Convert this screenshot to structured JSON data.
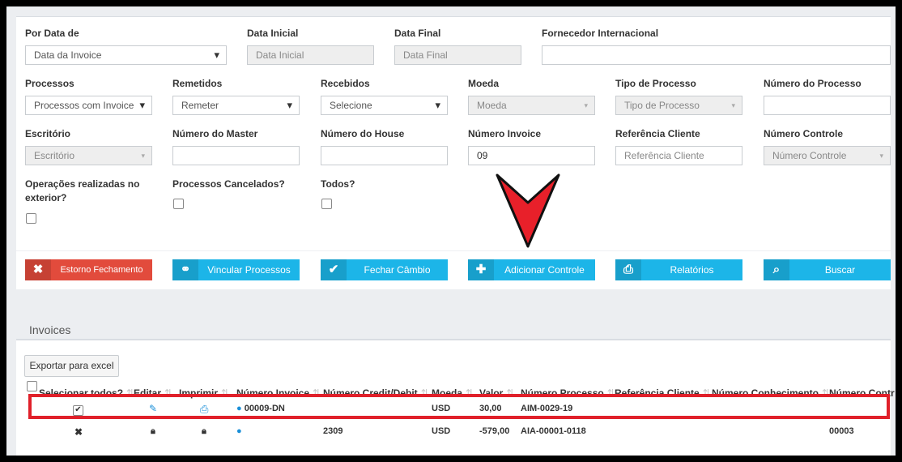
{
  "filters": {
    "por_data_de": {
      "label": "Por Data de",
      "value": "Data da Invoice"
    },
    "data_inicial": {
      "label": "Data Inicial",
      "placeholder": "Data Inicial"
    },
    "data_final": {
      "label": "Data Final",
      "placeholder": "Data Final"
    },
    "fornecedor": {
      "label": "Fornecedor Internacional",
      "value": ""
    },
    "processos": {
      "label": "Processos",
      "value": "Processos com Invoice"
    },
    "remetidos": {
      "label": "Remetidos",
      "value": "Remeter"
    },
    "recebidos": {
      "label": "Recebidos",
      "value": "Selecione"
    },
    "moeda": {
      "label": "Moeda",
      "value": "Moeda"
    },
    "tipo_processo": {
      "label": "Tipo de Processo",
      "value": "Tipo de Processo"
    },
    "numero_processo": {
      "label": "Número do Processo",
      "value": ""
    },
    "escritorio": {
      "label": "Escritório",
      "value": "Escritório"
    },
    "numero_master": {
      "label": "Número do Master",
      "value": ""
    },
    "numero_house": {
      "label": "Número do House",
      "value": ""
    },
    "numero_invoice": {
      "label": "Número Invoice",
      "value": "09"
    },
    "referencia_cliente": {
      "label": "Referência Cliente",
      "placeholder": "Referência Cliente"
    },
    "numero_controle": {
      "label": "Número Controle",
      "value": "Número Controle"
    },
    "operacoes_exterior": {
      "label_line1": "Operações realizadas no",
      "label_line2": "exterior?"
    },
    "processos_cancelados": {
      "label": "Processos Cancelados?"
    },
    "todos": {
      "label": "Todos?"
    }
  },
  "actions": {
    "estorno": "Estorno Fechamento",
    "vincular": "Vincular Processos",
    "fechar": "Fechar Câmbio",
    "adicionar": "Adicionar Controle",
    "relatorios": "Relatórios",
    "buscar": "Buscar"
  },
  "invoices": {
    "title": "Invoices",
    "export_label": "Exportar para excel",
    "headers": {
      "selecionar": "Selecionar todos?",
      "editar": "Editar",
      "imprimir": "Imprimir",
      "numero_invoice": "Número Invoice",
      "numero_credit_debit": "Número Credit/Debit",
      "moeda": "Moeda",
      "valor": "Valor",
      "numero_processo": "Número Processo",
      "referencia_cliente": "Referência Cliente",
      "numero_conhecimento": "Número Conhecimento",
      "numero_controle": "Número Contr"
    },
    "rows": [
      {
        "invoice": "00009-DN",
        "credit_debit": "",
        "moeda": "USD",
        "valor": "30,00",
        "processo": "AIM-0029-19",
        "controle": ""
      },
      {
        "invoice": "",
        "credit_debit": "2309",
        "moeda": "USD",
        "valor": "-579,00",
        "processo": "AIA-00001-0118",
        "controle": "00003"
      }
    ]
  },
  "colors": {
    "accent": "#1cb5e8",
    "danger": "#e24b3c",
    "highlight": "#e0202a",
    "arrow": "#e8202a"
  },
  "icons": [
    "times-icon",
    "link-icon",
    "check-icon",
    "plus-icon",
    "print-icon",
    "search-icon",
    "edit-icon",
    "comment-icon",
    "lock-icon",
    "sort-icon"
  ]
}
